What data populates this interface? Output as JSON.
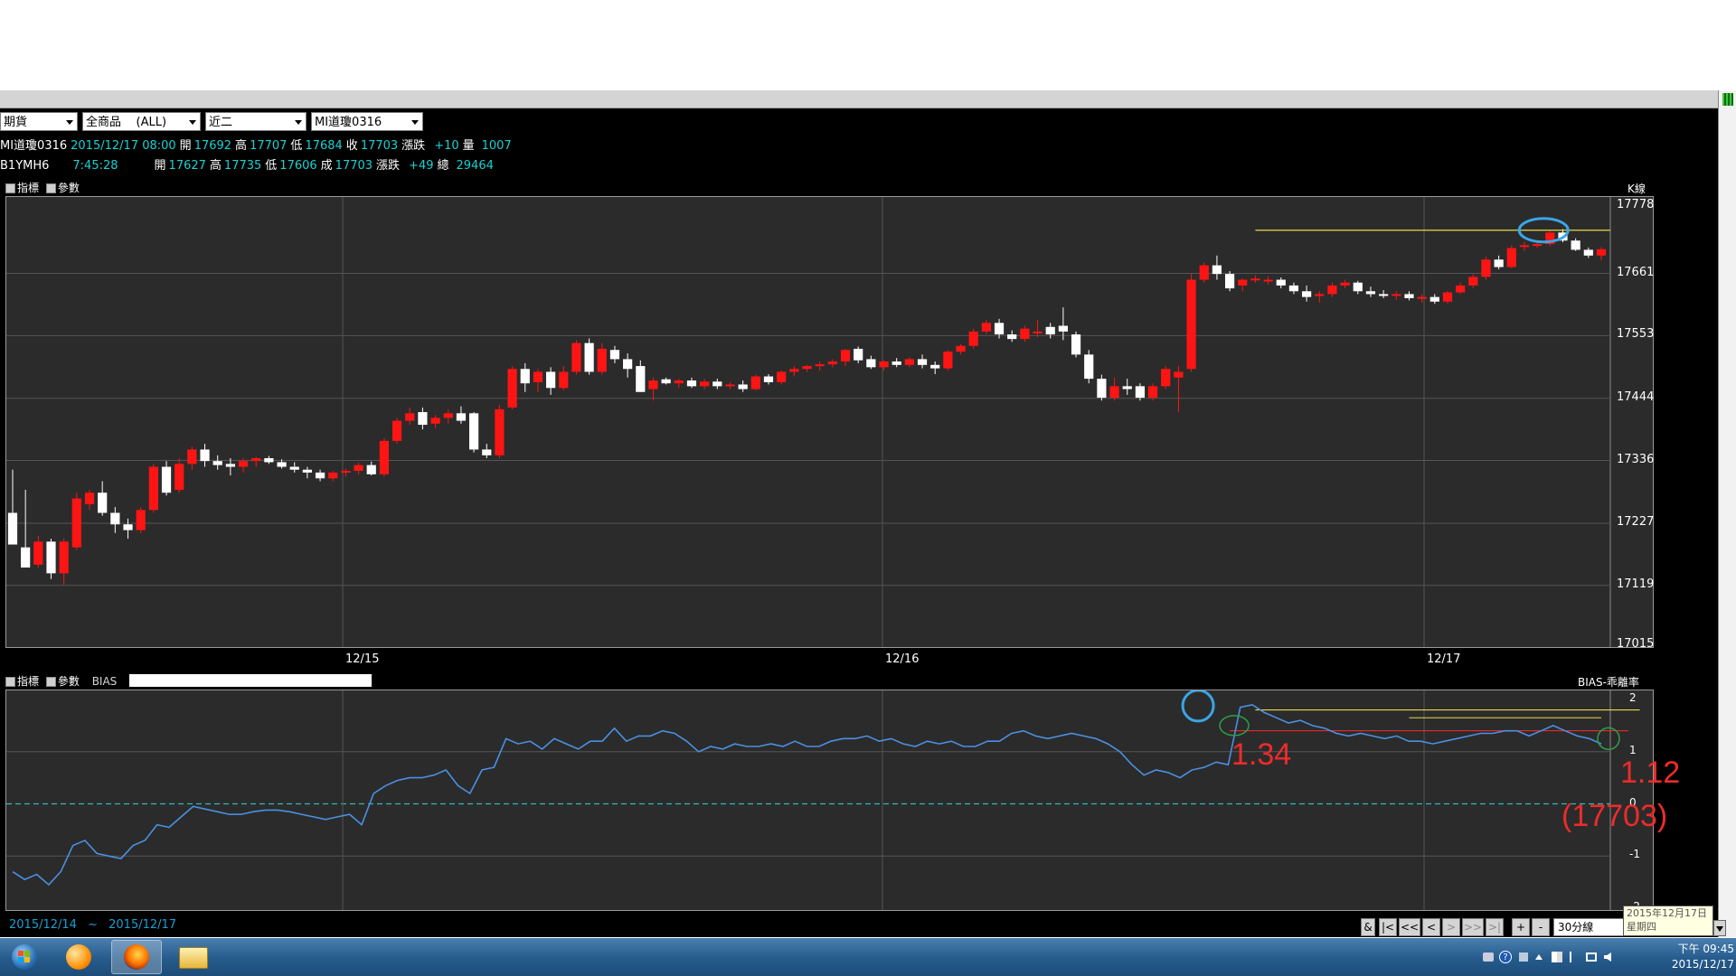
{
  "selectors": [
    {
      "value": "期貨"
    },
    {
      "value": "全商品    (ALL)"
    },
    {
      "value": "近二"
    },
    {
      "value": "MI道瓊0316"
    }
  ],
  "quote1": {
    "symbol": "MI道瓊0316",
    "datetime": "2015/12/17 08:00",
    "open_label": "開",
    "open": "17692",
    "high_label": "高",
    "high": "17707",
    "low_label": "低",
    "low": "17684",
    "close_label": "收",
    "close": "17703",
    "change_label": "漲跌",
    "change": "+10",
    "volume_label": "量",
    "volume": "1007"
  },
  "quote2": {
    "symbol": "B1YMH6",
    "time": "7:45:28",
    "open_label": "開",
    "open": "17627",
    "high_label": "高",
    "high": "17735",
    "low_label": "低",
    "low": "17606",
    "close_label": "成",
    "close": "17703",
    "change_label": "漲跌",
    "change": "+49",
    "volume_label": "總",
    "volume": "29464"
  },
  "main_panel": {
    "tool_indicator": "指標",
    "tool_param": "參數",
    "label_right": "K線"
  },
  "sub_panel": {
    "tool_indicator": "指標",
    "tool_param": "參數",
    "indicator": "BIAS",
    "label_right": "BIAS-乖離率"
  },
  "annotations": {
    "bias_peak": "1.34",
    "bias_current": "1.12",
    "bias_current_price": "(17703)"
  },
  "range": {
    "from": "2015/12/14",
    "sep": "~",
    "to": "2015/12/17"
  },
  "nav": {
    "amp": "&",
    "first": "|<",
    "prev_fast": "<<",
    "prev": "<",
    "next": ">",
    "next_fast": ">>",
    "last": ">|",
    "zoom_in": "+",
    "zoom_out": "-",
    "interval": "30分線"
  },
  "tooltip": {
    "date": "2015年12月17日",
    "weekday": "星期四"
  },
  "clock": {
    "time": "下午 09:45",
    "date": "2015/12/17"
  },
  "colors": {
    "up": "#ff1414",
    "down": "#ffffff",
    "bias_line": "#4a90e2",
    "zero_line": "#2fb8b8",
    "annotation": "#ee2b2b"
  },
  "chart_data": [
    {
      "type": "candlestick",
      "title": "K線",
      "ylabel": "",
      "ylim": [
        17015,
        17778
      ],
      "yticks": [
        17778,
        17661,
        17553,
        17444,
        17336,
        17227,
        17119,
        17015
      ],
      "xticks": [
        "12/15",
        "12/16",
        "12/17"
      ],
      "grid": true,
      "candles": [
        {
          "o": 17245,
          "h": 17320,
          "l": 17190,
          "c": 17190
        },
        {
          "o": 17185,
          "h": 17285,
          "l": 17150,
          "c": 17150
        },
        {
          "o": 17155,
          "h": 17205,
          "l": 17150,
          "c": 17195
        },
        {
          "o": 17195,
          "h": 17200,
          "l": 17130,
          "c": 17140
        },
        {
          "o": 17140,
          "h": 17200,
          "l": 17120,
          "c": 17195
        },
        {
          "o": 17185,
          "h": 17280,
          "l": 17180,
          "c": 17270
        },
        {
          "o": 17260,
          "h": 17285,
          "l": 17250,
          "c": 17280
        },
        {
          "o": 17280,
          "h": 17300,
          "l": 17240,
          "c": 17245
        },
        {
          "o": 17245,
          "h": 17255,
          "l": 17210,
          "c": 17225
        },
        {
          "o": 17225,
          "h": 17235,
          "l": 17200,
          "c": 17215
        },
        {
          "o": 17215,
          "h": 17255,
          "l": 17210,
          "c": 17250
        },
        {
          "o": 17250,
          "h": 17330,
          "l": 17245,
          "c": 17325
        },
        {
          "o": 17325,
          "h": 17335,
          "l": 17275,
          "c": 17280
        },
        {
          "o": 17285,
          "h": 17340,
          "l": 17280,
          "c": 17330
        },
        {
          "o": 17330,
          "h": 17360,
          "l": 17320,
          "c": 17355
        },
        {
          "o": 17355,
          "h": 17365,
          "l": 17325,
          "c": 17335
        },
        {
          "o": 17335,
          "h": 17345,
          "l": 17320,
          "c": 17328
        },
        {
          "o": 17330,
          "h": 17340,
          "l": 17310,
          "c": 17325
        },
        {
          "o": 17325,
          "h": 17340,
          "l": 17315,
          "c": 17335
        },
        {
          "o": 17335,
          "h": 17342,
          "l": 17325,
          "c": 17340
        },
        {
          "o": 17340,
          "h": 17344,
          "l": 17330,
          "c": 17333
        },
        {
          "o": 17333,
          "h": 17338,
          "l": 17322,
          "c": 17325
        },
        {
          "o": 17325,
          "h": 17333,
          "l": 17315,
          "c": 17320
        },
        {
          "o": 17320,
          "h": 17325,
          "l": 17305,
          "c": 17315
        },
        {
          "o": 17315,
          "h": 17320,
          "l": 17300,
          "c": 17305
        },
        {
          "o": 17305,
          "h": 17318,
          "l": 17300,
          "c": 17315
        },
        {
          "o": 17315,
          "h": 17322,
          "l": 17308,
          "c": 17318
        },
        {
          "o": 17318,
          "h": 17332,
          "l": 17312,
          "c": 17328
        },
        {
          "o": 17328,
          "h": 17334,
          "l": 17310,
          "c": 17312
        },
        {
          "o": 17312,
          "h": 17375,
          "l": 17308,
          "c": 17370
        },
        {
          "o": 17370,
          "h": 17410,
          "l": 17365,
          "c": 17405
        },
        {
          "o": 17405,
          "h": 17428,
          "l": 17398,
          "c": 17418
        },
        {
          "o": 17420,
          "h": 17428,
          "l": 17390,
          "c": 17398
        },
        {
          "o": 17400,
          "h": 17415,
          "l": 17392,
          "c": 17410
        },
        {
          "o": 17410,
          "h": 17425,
          "l": 17400,
          "c": 17418
        },
        {
          "o": 17418,
          "h": 17430,
          "l": 17400,
          "c": 17405
        },
        {
          "o": 17418,
          "h": 17420,
          "l": 17350,
          "c": 17355
        },
        {
          "o": 17355,
          "h": 17365,
          "l": 17340,
          "c": 17345
        },
        {
          "o": 17345,
          "h": 17432,
          "l": 17340,
          "c": 17425
        },
        {
          "o": 17428,
          "h": 17500,
          "l": 17425,
          "c": 17495
        },
        {
          "o": 17495,
          "h": 17505,
          "l": 17455,
          "c": 17470
        },
        {
          "o": 17472,
          "h": 17495,
          "l": 17455,
          "c": 17490
        },
        {
          "o": 17490,
          "h": 17498,
          "l": 17450,
          "c": 17462
        },
        {
          "o": 17462,
          "h": 17500,
          "l": 17458,
          "c": 17490
        },
        {
          "o": 17490,
          "h": 17545,
          "l": 17485,
          "c": 17540
        },
        {
          "o": 17540,
          "h": 17548,
          "l": 17485,
          "c": 17490
        },
        {
          "o": 17490,
          "h": 17540,
          "l": 17485,
          "c": 17530
        },
        {
          "o": 17528,
          "h": 17535,
          "l": 17505,
          "c": 17512
        },
        {
          "o": 17512,
          "h": 17522,
          "l": 17480,
          "c": 17495
        },
        {
          "o": 17500,
          "h": 17510,
          "l": 17455,
          "c": 17455
        },
        {
          "o": 17460,
          "h": 17480,
          "l": 17440,
          "c": 17475
        },
        {
          "o": 17477,
          "h": 17480,
          "l": 17468,
          "c": 17470
        },
        {
          "o": 17470,
          "h": 17478,
          "l": 17462,
          "c": 17475
        },
        {
          "o": 17475,
          "h": 17480,
          "l": 17462,
          "c": 17465
        },
        {
          "o": 17465,
          "h": 17478,
          "l": 17460,
          "c": 17473
        },
        {
          "o": 17473,
          "h": 17478,
          "l": 17460,
          "c": 17465
        },
        {
          "o": 17465,
          "h": 17472,
          "l": 17460,
          "c": 17468
        },
        {
          "o": 17468,
          "h": 17475,
          "l": 17455,
          "c": 17460
        },
        {
          "o": 17460,
          "h": 17485,
          "l": 17458,
          "c": 17482
        },
        {
          "o": 17482,
          "h": 17486,
          "l": 17468,
          "c": 17472
        },
        {
          "o": 17472,
          "h": 17492,
          "l": 17468,
          "c": 17490
        },
        {
          "o": 17490,
          "h": 17500,
          "l": 17482,
          "c": 17495
        },
        {
          "o": 17495,
          "h": 17502,
          "l": 17490,
          "c": 17500
        },
        {
          "o": 17500,
          "h": 17508,
          "l": 17492,
          "c": 17503
        },
        {
          "o": 17503,
          "h": 17512,
          "l": 17498,
          "c": 17508
        },
        {
          "o": 17508,
          "h": 17530,
          "l": 17500,
          "c": 17528
        },
        {
          "o": 17530,
          "h": 17534,
          "l": 17505,
          "c": 17510
        },
        {
          "o": 17512,
          "h": 17518,
          "l": 17495,
          "c": 17498
        },
        {
          "o": 17498,
          "h": 17510,
          "l": 17492,
          "c": 17508
        },
        {
          "o": 17508,
          "h": 17514,
          "l": 17498,
          "c": 17502
        },
        {
          "o": 17502,
          "h": 17515,
          "l": 17498,
          "c": 17512
        },
        {
          "o": 17512,
          "h": 17520,
          "l": 17496,
          "c": 17502
        },
        {
          "o": 17502,
          "h": 17508,
          "l": 17486,
          "c": 17496
        },
        {
          "o": 17496,
          "h": 17528,
          "l": 17492,
          "c": 17525
        },
        {
          "o": 17525,
          "h": 17538,
          "l": 17520,
          "c": 17535
        },
        {
          "o": 17535,
          "h": 17565,
          "l": 17530,
          "c": 17560
        },
        {
          "o": 17560,
          "h": 17580,
          "l": 17555,
          "c": 17575
        },
        {
          "o": 17575,
          "h": 17582,
          "l": 17548,
          "c": 17555
        },
        {
          "o": 17555,
          "h": 17562,
          "l": 17542,
          "c": 17547
        },
        {
          "o": 17547,
          "h": 17570,
          "l": 17542,
          "c": 17565
        },
        {
          "o": 17560,
          "h": 17580,
          "l": 17550,
          "c": 17560
        },
        {
          "o": 17568,
          "h": 17575,
          "l": 17548,
          "c": 17555
        },
        {
          "o": 17570,
          "h": 17602,
          "l": 17545,
          "c": 17560
        },
        {
          "o": 17555,
          "h": 17560,
          "l": 17515,
          "c": 17520
        },
        {
          "o": 17520,
          "h": 17528,
          "l": 17470,
          "c": 17478
        },
        {
          "o": 17478,
          "h": 17485,
          "l": 17440,
          "c": 17445
        },
        {
          "o": 17445,
          "h": 17480,
          "l": 17440,
          "c": 17465
        },
        {
          "o": 17465,
          "h": 17478,
          "l": 17450,
          "c": 17460
        },
        {
          "o": 17465,
          "h": 17470,
          "l": 17440,
          "c": 17445
        },
        {
          "o": 17445,
          "h": 17470,
          "l": 17440,
          "c": 17465
        },
        {
          "o": 17465,
          "h": 17500,
          "l": 17460,
          "c": 17495
        },
        {
          "o": 17480,
          "h": 17500,
          "l": 17420,
          "c": 17490
        },
        {
          "o": 17495,
          "h": 17660,
          "l": 17490,
          "c": 17650
        },
        {
          "o": 17650,
          "h": 17680,
          "l": 17645,
          "c": 17675
        },
        {
          "o": 17675,
          "h": 17692,
          "l": 17650,
          "c": 17660
        },
        {
          "o": 17660,
          "h": 17665,
          "l": 17630,
          "c": 17635
        },
        {
          "o": 17640,
          "h": 17652,
          "l": 17630,
          "c": 17650
        },
        {
          "o": 17650,
          "h": 17658,
          "l": 17645,
          "c": 17652
        },
        {
          "o": 17650,
          "h": 17656,
          "l": 17642,
          "c": 17650
        },
        {
          "o": 17650,
          "h": 17654,
          "l": 17635,
          "c": 17640
        },
        {
          "o": 17640,
          "h": 17645,
          "l": 17625,
          "c": 17630
        },
        {
          "o": 17630,
          "h": 17640,
          "l": 17612,
          "c": 17620
        },
        {
          "o": 17625,
          "h": 17630,
          "l": 17610,
          "c": 17625
        },
        {
          "o": 17625,
          "h": 17645,
          "l": 17620,
          "c": 17640
        },
        {
          "o": 17640,
          "h": 17650,
          "l": 17635,
          "c": 17645
        },
        {
          "o": 17645,
          "h": 17648,
          "l": 17625,
          "c": 17630
        },
        {
          "o": 17630,
          "h": 17638,
          "l": 17620,
          "c": 17625
        },
        {
          "o": 17625,
          "h": 17632,
          "l": 17618,
          "c": 17622
        },
        {
          "o": 17622,
          "h": 17630,
          "l": 17615,
          "c": 17625
        },
        {
          "o": 17625,
          "h": 17630,
          "l": 17614,
          "c": 17618
        },
        {
          "o": 17618,
          "h": 17625,
          "l": 17610,
          "c": 17620
        },
        {
          "o": 17620,
          "h": 17625,
          "l": 17608,
          "c": 17612
        },
        {
          "o": 17612,
          "h": 17630,
          "l": 17608,
          "c": 17628
        },
        {
          "o": 17628,
          "h": 17645,
          "l": 17625,
          "c": 17640
        },
        {
          "o": 17640,
          "h": 17660,
          "l": 17635,
          "c": 17655
        },
        {
          "o": 17655,
          "h": 17690,
          "l": 17650,
          "c": 17685
        },
        {
          "o": 17685,
          "h": 17692,
          "l": 17668,
          "c": 17672
        },
        {
          "o": 17672,
          "h": 17710,
          "l": 17670,
          "c": 17705
        },
        {
          "o": 17708,
          "h": 17716,
          "l": 17700,
          "c": 17710
        },
        {
          "o": 17710,
          "h": 17718,
          "l": 17705,
          "c": 17712
        },
        {
          "o": 17712,
          "h": 17735,
          "l": 17708,
          "c": 17732
        },
        {
          "o": 17732,
          "h": 17738,
          "l": 17715,
          "c": 17718
        },
        {
          "o": 17718,
          "h": 17722,
          "l": 17700,
          "c": 17702
        },
        {
          "o": 17702,
          "h": 17706,
          "l": 17688,
          "c": 17692
        },
        {
          "o": 17692,
          "h": 17707,
          "l": 17684,
          "c": 17703
        }
      ],
      "resistance_level": 17736
    },
    {
      "type": "line",
      "title": "BIAS-乖離率",
      "ylim": [
        -2,
        2
      ],
      "yticks": [
        2,
        1,
        0,
        -1,
        -2
      ],
      "grid": true,
      "series": [
        {
          "name": "BIAS",
          "values": [
            -1.3,
            -1.45,
            -1.35,
            -1.55,
            -1.3,
            -0.8,
            -0.7,
            -0.95,
            -1.0,
            -1.05,
            -0.8,
            -0.7,
            -0.4,
            -0.45,
            -0.25,
            -0.05,
            -0.1,
            -0.15,
            -0.2,
            -0.2,
            -0.15,
            -0.12,
            -0.12,
            -0.15,
            -0.2,
            -0.25,
            -0.3,
            -0.25,
            -0.2,
            -0.4,
            0.2,
            0.35,
            0.45,
            0.5,
            0.5,
            0.55,
            0.65,
            0.35,
            0.2,
            0.65,
            0.7,
            1.25,
            1.15,
            1.2,
            1.05,
            1.25,
            1.15,
            1.05,
            1.2,
            1.2,
            1.45,
            1.2,
            1.3,
            1.3,
            1.4,
            1.35,
            1.2,
            1.0,
            1.1,
            1.05,
            1.15,
            1.1,
            1.1,
            1.15,
            1.1,
            1.2,
            1.1,
            1.1,
            1.2,
            1.25,
            1.25,
            1.3,
            1.2,
            1.25,
            1.15,
            1.1,
            1.2,
            1.15,
            1.2,
            1.1,
            1.1,
            1.2,
            1.2,
            1.35,
            1.4,
            1.3,
            1.25,
            1.3,
            1.35,
            1.3,
            1.25,
            1.15,
            1.0,
            0.75,
            0.55,
            0.65,
            0.6,
            0.5,
            0.65,
            0.7,
            0.8,
            0.75,
            1.85,
            1.9,
            1.75,
            1.65,
            1.55,
            1.6,
            1.5,
            1.45,
            1.35,
            1.3,
            1.35,
            1.3,
            1.25,
            1.3,
            1.2,
            1.2,
            1.15,
            1.2,
            1.25,
            1.3,
            1.35,
            1.35,
            1.4,
            1.4,
            1.3,
            1.4,
            1.5,
            1.4,
            1.3,
            1.25,
            1.15
          ]
        }
      ],
      "guides": {
        "high_level": 1.8,
        "peak_level": 1.34,
        "current": 1.12
      }
    }
  ]
}
